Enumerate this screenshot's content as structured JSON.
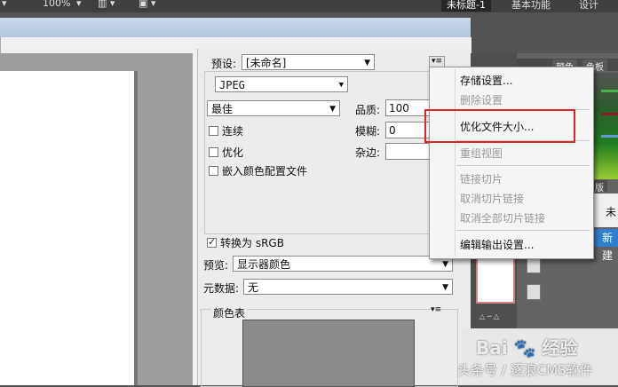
{
  "topbar": {
    "zoom": "100%",
    "workspace_current": "未标题-1",
    "workspace_basic": "基本功能",
    "workspace_design": "设计"
  },
  "settings": {
    "preset_label": "预设:",
    "preset_value": "[未命名]",
    "format_value": "JPEG",
    "quality_preset": "最佳",
    "quality_label": "品质:",
    "quality_value": "100",
    "blur_label": "模糊:",
    "blur_value": "0",
    "matte_label": "杂边:",
    "progressive_label": "连续",
    "optimized_label": "优化",
    "embed_profile_label": "嵌入颜色配置文件",
    "convert_srgb_label": "转换为 sRGB",
    "preview_label": "预览:",
    "preview_value": "显示器颜色",
    "metadata_label": "元数据:",
    "metadata_value": "无",
    "color_table_label": "颜色表"
  },
  "context_menu": {
    "items": [
      {
        "label": "存储设置...",
        "enabled": true
      },
      {
        "label": "删除设置",
        "enabled": false
      },
      {
        "label": "优化文件大小...",
        "enabled": true
      },
      {
        "label": "重组视图",
        "enabled": false
      },
      {
        "label": "链接切片",
        "enabled": false
      },
      {
        "label": "取消切片链接",
        "enabled": false
      },
      {
        "label": "取消全部切片链接",
        "enabled": false
      },
      {
        "label": "编辑输出设置...",
        "enabled": true
      }
    ]
  },
  "right_panel": {
    "tab_color": "颜色",
    "tab_swatches": "色板",
    "tab_version": "版",
    "text_partial": "未",
    "new_button": "新建"
  },
  "watermark": {
    "brand": "Bai",
    "brand_cn": "经验",
    "credit": "头条号 / 逐浪CMS软件"
  },
  "colors": {
    "highlight_border": "#d9262a",
    "dialog_bg": "#f0f0f0",
    "workspace_bg": "#535353"
  },
  "icons": {
    "panel_menu": "panel-menu-icon",
    "dropdown": "chevron-down-icon",
    "checkbox_checked": "checkmark-icon"
  }
}
